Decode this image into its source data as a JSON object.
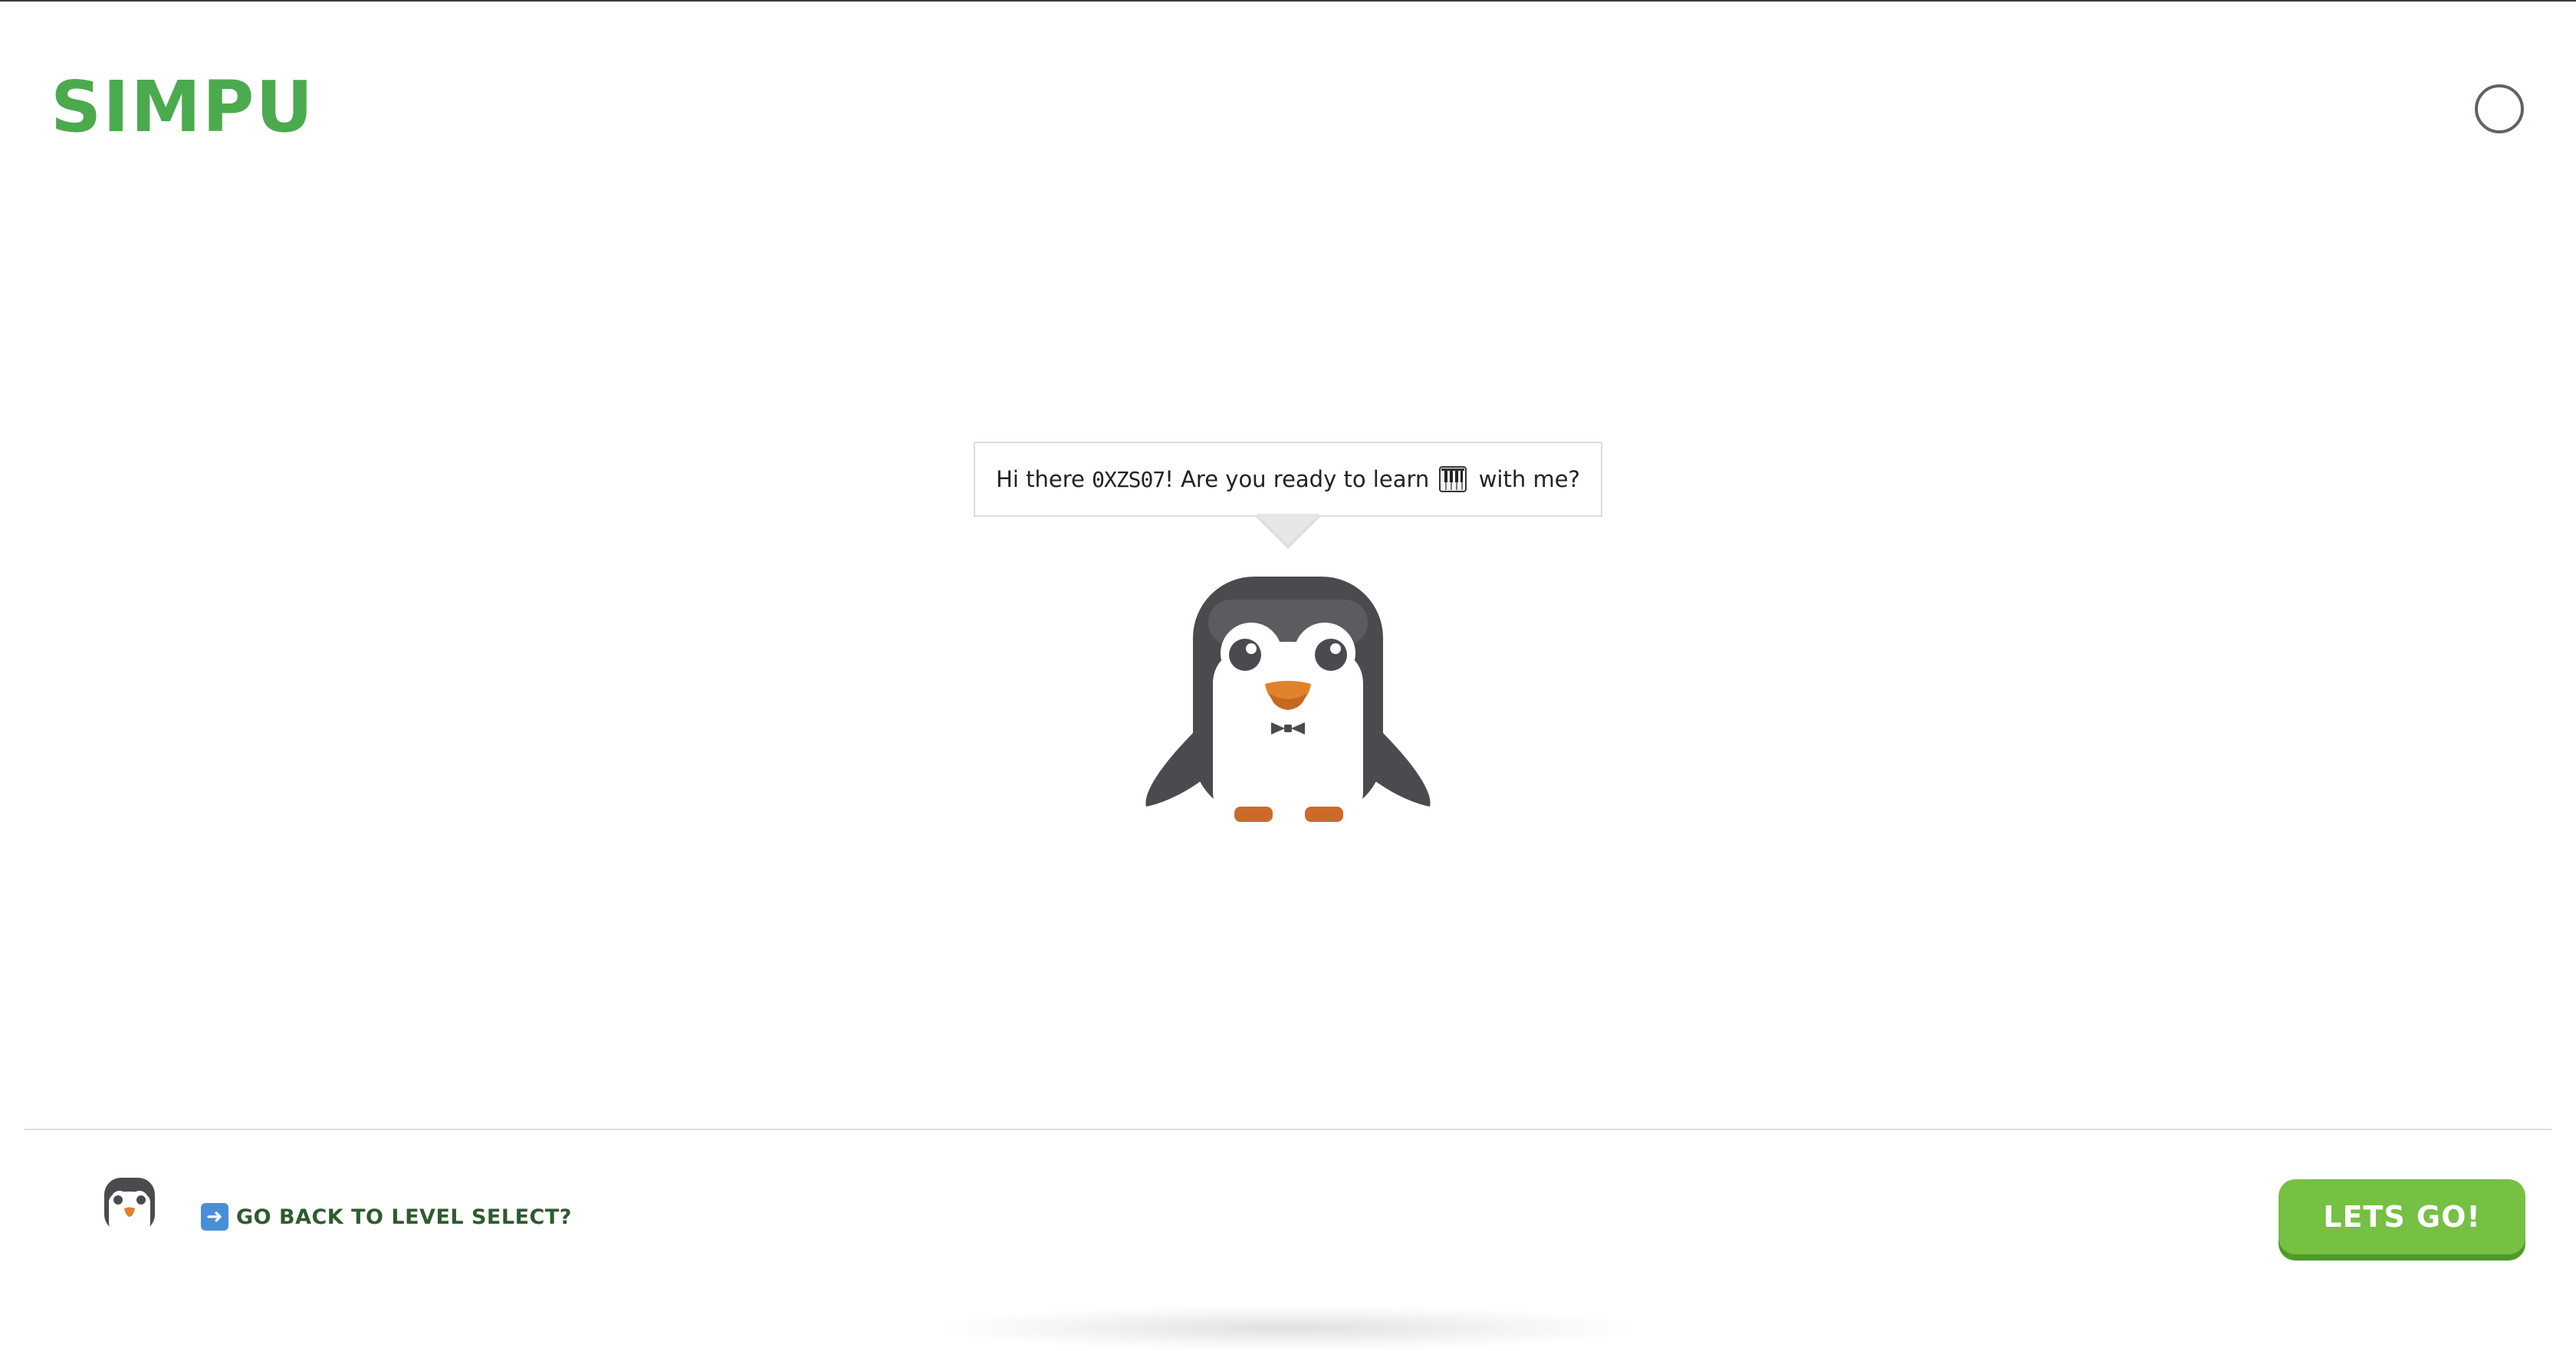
{
  "header": {
    "logo_text": "SIMPU",
    "profile_button_icon": "profile-circle-icon"
  },
  "speech_bubble": {
    "greeting_prefix": "Hi there",
    "username": "0XZS07",
    "greeting_middle": "! Are you ready to learn",
    "emoji": "piano-keys-icon",
    "greeting_suffix": "with me?"
  },
  "mascot": {
    "name": "penguin-mascot"
  },
  "footer": {
    "back_link_label": "GO BACK TO LEVEL SELECT?",
    "back_link_icon": "right-arrow-icon",
    "cta_label": "LETS GO!",
    "colors": {
      "brand_green": "#4caa4e",
      "cta_green": "#76c043",
      "link_green": "#2f5b2f"
    }
  }
}
